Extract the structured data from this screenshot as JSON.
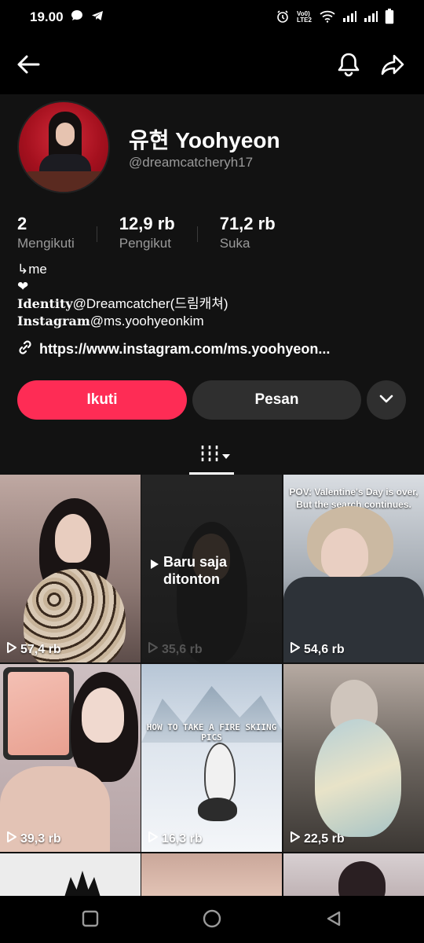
{
  "status": {
    "time": "19.00",
    "left_icons": [
      "chat-bubble-icon",
      "telegram-icon"
    ],
    "right_icons": [
      "alarm-icon",
      "volte-icon",
      "wifi-icon",
      "signal-icon",
      "signal-icon",
      "battery-icon"
    ],
    "network_label": "Vo0) LTE2"
  },
  "topbar": {
    "back_icon": "arrow-left-icon",
    "notification_icon": "bell-icon",
    "share_icon": "share-arrow-icon"
  },
  "profile": {
    "name": "유현 Yoohyeon",
    "handle": "@dreamcatcheryh17",
    "stats": [
      {
        "value": "2",
        "label": "Mengikuti"
      },
      {
        "value": "12,9 rb",
        "label": "Pengikut"
      },
      {
        "value": "71,2 rb",
        "label": "Suka"
      }
    ],
    "bio": {
      "line1": "↳me",
      "line2": "❤",
      "line3_bold": "𝐈𝐝𝐞𝐧𝐭𝐢𝐭𝐲",
      "line3_rest": "@Dreamcatcher(드림캐쳐)",
      "line4_bold": "𝐈𝐧𝐬𝐭𝐚𝐠𝐫𝐚𝐦",
      "line4_rest": "@ms.yoohyeonkim"
    },
    "link": "https://www.instagram.com/ms.yoohyeon..."
  },
  "actions": {
    "follow": "Ikuti",
    "message": "Pesan",
    "more_icon": "chevron-down-icon"
  },
  "tabs": {
    "videos_icon": "grid-bars-icon",
    "dropdown_icon": "caret-down-icon"
  },
  "videos": [
    {
      "views": "57,4 rb",
      "caption": ""
    },
    {
      "views": "35,6 rb",
      "caption": "Baru saja ditonton"
    },
    {
      "views": "54,6 rb",
      "caption": "POV: Valentine's Day is over, But the search continues."
    },
    {
      "views": "39,3 rb",
      "caption": ""
    },
    {
      "views": "16,3 rb",
      "caption": "HOW TO TAKE A FIRE SKIING PICS"
    },
    {
      "views": "22,5 rb",
      "caption": ""
    }
  ],
  "navbar": {
    "icons": [
      "square-recent-icon",
      "circle-home-icon",
      "triangle-back-icon"
    ]
  },
  "colors": {
    "accent": "#fe2c55",
    "background": "#121212",
    "secondary_button": "#2f2f2f",
    "muted_text": "#9a9a9a"
  }
}
